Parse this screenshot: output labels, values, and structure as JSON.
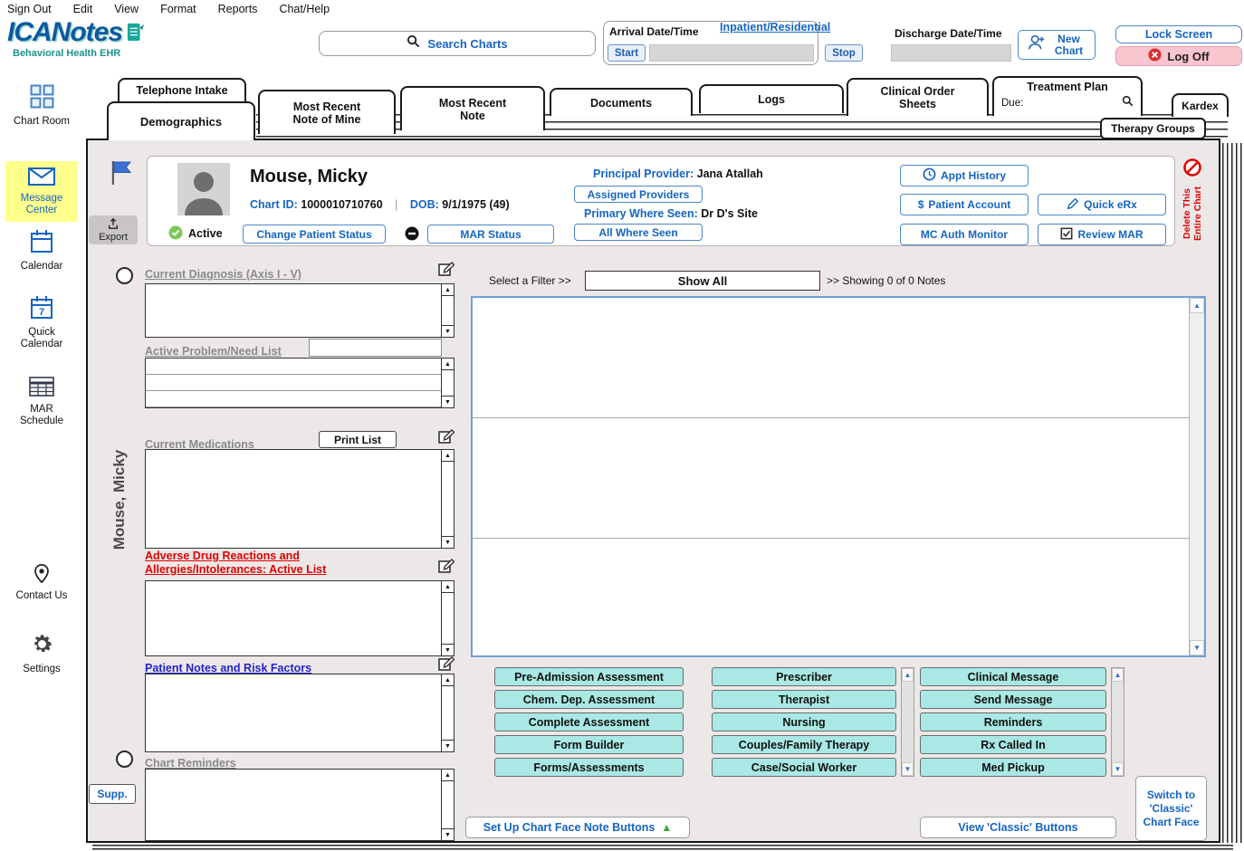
{
  "colors": {
    "accent_blue": "#1565C0",
    "cyan_button": "#A9E8E4",
    "highlight_yellow": "#FFFF8C",
    "alert_red": "#E00000",
    "logoff_pink": "#F9C5CE",
    "chart_face_bg": "#EDE8E8"
  },
  "menu": {
    "items": [
      "Sign Out",
      "Edit",
      "View",
      "Format",
      "Reports",
      "Chat/Help"
    ]
  },
  "header": {
    "logo_main": "ICANotes",
    "logo_sub": "Behavioral Health EHR",
    "search_label": "Search Charts",
    "arrival_label": "Arrival Date/Time",
    "start_button": "Start",
    "inpatient_link": "Inpatient/Residential",
    "stop_button": "Stop",
    "discharge_label": "Discharge Date/Time",
    "new_chart_button": "New Chart",
    "lock_screen_button": "Lock Screen",
    "log_off_button": "Log Off"
  },
  "sidebar": {
    "items": [
      {
        "label": "Chart Room",
        "icon": "grid-icon"
      },
      {
        "label": "Message Center",
        "icon": "envelope-icon"
      },
      {
        "label": "Calendar",
        "icon": "calendar-icon"
      },
      {
        "label": "Quick Calendar",
        "icon": "quick-calendar-icon"
      },
      {
        "label": "MAR Schedule",
        "icon": "table-icon"
      },
      {
        "label": "Contact Us",
        "icon": "map-pin-icon"
      },
      {
        "label": "Settings",
        "icon": "gear-icon"
      }
    ]
  },
  "tabs": {
    "telephone_intake": "Telephone Intake",
    "demographics": "Demographics",
    "most_recent_note_of_mine": "Most Recent Note of Mine",
    "most_recent_note": "Most Recent Note",
    "documents": "Documents",
    "logs": "Logs",
    "clinical_order_sheets": "Clinical Order Sheets",
    "treatment_plan": "Treatment Plan",
    "treatment_plan_due_label": "Due:",
    "kardex": "Kardex",
    "therapy_groups": "Therapy Groups"
  },
  "patient": {
    "name": "Mouse, Micky",
    "vertical_name": "Mouse, Micky",
    "chart_id_label": "Chart ID:",
    "chart_id": "1000010710760",
    "id_separator": "|",
    "dob_label": "DOB:",
    "dob_value": "9/1/1975 (49)",
    "status": "Active",
    "export_button": "Export",
    "change_patient_status_button": "Change Patient Status",
    "mar_status_button": "MAR Status",
    "principal_provider_label": "Principal Provider:",
    "principal_provider": "Jana Atallah",
    "assigned_providers_button": "Assigned Providers",
    "primary_where_seen_label": "Primary Where Seen:",
    "primary_where_seen": "Dr D's Site",
    "all_where_seen_button": "All Where Seen",
    "appt_history_button": "Appt History",
    "patient_account_button": "Patient Account",
    "patient_account_icon": "$",
    "quick_erx_button": "Quick eRx",
    "mc_auth_monitor_button": "MC Auth Monitor",
    "review_mar_button": "Review MAR",
    "delete_chart_line1": "Delete This",
    "delete_chart_line2": "Entire Chart"
  },
  "sections": {
    "current_diagnosis_label": "Current Diagnosis (Axis I - V)",
    "active_problem_label": "Active Problem/Need List",
    "current_medications_label": "Current Medications",
    "print_list_button": "Print List",
    "adverse_label": "Adverse Drug Reactions and Allergies/Intolerances:  Active List",
    "patient_notes_label": "Patient Notes and Risk Factors",
    "chart_reminders_label": "Chart Reminders",
    "supp_button": "Supp."
  },
  "notes_panel": {
    "select_filter_label": "Select a Filter >>",
    "show_all_button": "Show All",
    "showing_label": ">> Showing 0 of 0 Notes"
  },
  "note_buttons": {
    "col1": [
      "Pre-Admission Assessment",
      "Chem. Dep. Assessment",
      "Complete Assessment",
      "Form Builder",
      "Forms/Assessments"
    ],
    "col2": [
      "Prescriber",
      "Therapist",
      "Nursing",
      "Couples/Family Therapy",
      "Case/Social Worker"
    ],
    "col3": [
      "Clinical Message",
      "Send Message",
      "Reminders",
      "Rx Called In",
      "Med Pickup"
    ]
  },
  "footer": {
    "setup_note_buttons": "Set Up Chart Face Note Buttons",
    "view_classic_buttons": "View 'Classic' Buttons",
    "switch_classic": "Switch to 'Classic' Chart Face"
  },
  "icons_glyphs": {
    "scroll_up": "▲",
    "scroll_down": "▼",
    "setup_triangle": "▲"
  }
}
